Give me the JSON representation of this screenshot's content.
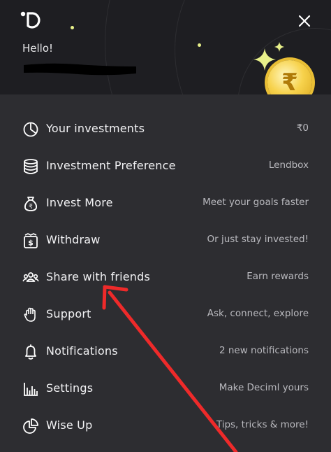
{
  "header": {
    "greeting": "Hello!",
    "logo_icon": "deciml-logo-icon",
    "close_icon": "close-icon",
    "coin_symbol": "₹",
    "accent": "#e8f08a",
    "coin_color": "#f2c93a"
  },
  "menu": {
    "items": [
      {
        "label": "Your investments",
        "sub": "₹0",
        "icon": "pie-chart-icon"
      },
      {
        "label": "Investment Preference",
        "sub": "Lendbox",
        "icon": "database-stack-icon"
      },
      {
        "label": "Invest More",
        "sub": "Meet your goals faster",
        "icon": "money-bag-icon"
      },
      {
        "label": "Withdraw",
        "sub": "Or just stay invested!",
        "icon": "cash-withdraw-icon"
      },
      {
        "label": "Share with friends",
        "sub": "Earn rewards",
        "icon": "group-people-icon"
      },
      {
        "label": "Support",
        "sub": "Ask, connect, explore",
        "icon": "hand-icon"
      },
      {
        "label": "Notifications",
        "sub": "2 new notifications",
        "icon": "bell-icon"
      },
      {
        "label": "Settings",
        "sub": "Make Deciml yours",
        "icon": "bar-chart-icon"
      },
      {
        "label": "Wise Up",
        "sub": "Tips, tricks & more!",
        "icon": "pie-slice-icon"
      }
    ]
  },
  "annotation": {
    "arrow_color": "#ee2a2a",
    "arrow_icon": "red-arrow-annotation"
  }
}
